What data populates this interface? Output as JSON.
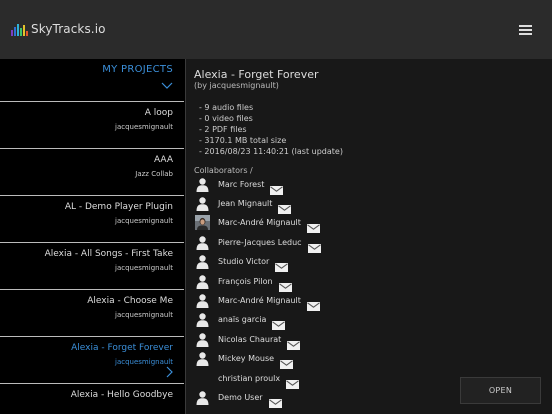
{
  "app": {
    "logo_text": "SkyTracks.io",
    "logo_colors": [
      "#7b3fc4",
      "#2f6fd6",
      "#2fb3d6",
      "#3cc36b",
      "#e3c32b",
      "#e2562a"
    ],
    "menu_icon": "hamburger-icon",
    "accent_color": "#3b8fd9"
  },
  "sidebar": {
    "title": "MY PROJECTS",
    "collapse_icon": "chevron-down-icon",
    "projects": [
      {
        "title": "A loop",
        "owner": "jacquesmignault",
        "selected": false
      },
      {
        "title": "AAA",
        "owner": "Jazz Collab",
        "selected": false
      },
      {
        "title": "AL - Demo Player Plugin",
        "owner": "jacquesmignault",
        "selected": false
      },
      {
        "title": "Alexia - All Songs - First Take",
        "owner": "jacquesmignault",
        "selected": false
      },
      {
        "title": "Alexia - Choose Me",
        "owner": "jacquesmignault",
        "selected": false
      },
      {
        "title": "Alexia - Forget Forever",
        "owner": "jacquesmignault",
        "selected": true
      },
      {
        "title": "Alexia - Hello Goodbye",
        "owner": "",
        "selected": false
      }
    ]
  },
  "project": {
    "title": "Alexia - Forget Forever",
    "subtitle": "(by jacquesmignault)",
    "stats": [
      "- 9 audio files",
      "- 0 video files",
      "- 2 PDF files",
      "- 3170.1 MB total size",
      "- 2016/08/23 11:40:21 (last update)"
    ],
    "collaborators_label": "Collaborators /",
    "collaborators": [
      {
        "name": "Marc Forest",
        "avatar": "user-silhouette-icon"
      },
      {
        "name": "Jean Mignault",
        "avatar": "user-silhouette-icon"
      },
      {
        "name": "Marc-André Mignault",
        "avatar": "user-photo"
      },
      {
        "name": "Pierre-Jacques Leduc",
        "avatar": "user-silhouette-icon"
      },
      {
        "name": "Studio Victor",
        "avatar": "user-silhouette-icon"
      },
      {
        "name": "François Pilon",
        "avatar": "user-silhouette-icon"
      },
      {
        "name": "Marc-André Mignault",
        "avatar": "user-silhouette-icon"
      },
      {
        "name": "anaïs garcia",
        "avatar": "user-silhouette-icon"
      },
      {
        "name": "Nicolas Chaurat",
        "avatar": "user-silhouette-icon"
      },
      {
        "name": "Mickey Mouse",
        "avatar": "user-silhouette-icon"
      },
      {
        "name": "christian proulx",
        "avatar": "none"
      },
      {
        "name": "Demo User",
        "avatar": "user-silhouette-icon"
      }
    ],
    "open_label": "OPEN"
  }
}
